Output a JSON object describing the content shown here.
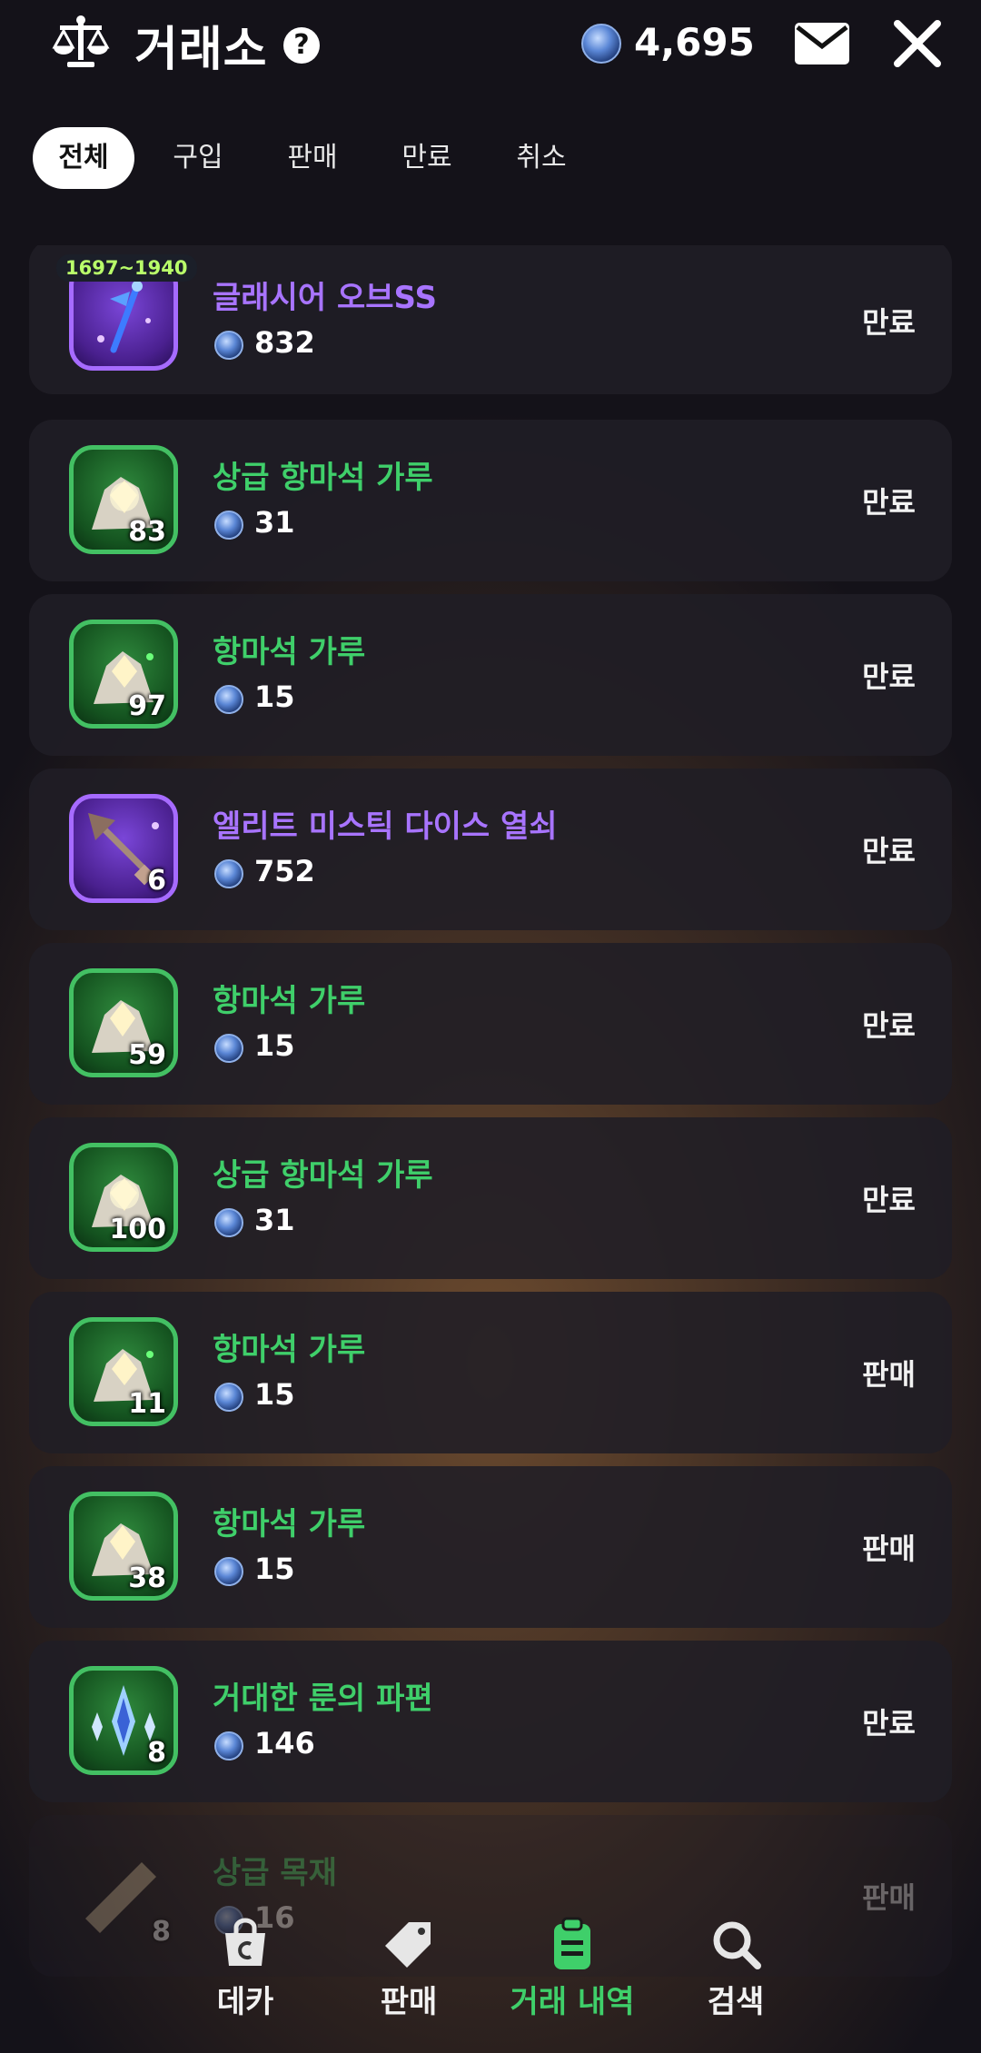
{
  "header": {
    "title": "거래소",
    "help_icon": "question-icon",
    "balance": "4,695",
    "mail_icon": "mail-icon",
    "close_icon": "close-icon"
  },
  "tabs": [
    {
      "label": "전체",
      "active": true
    },
    {
      "label": "구입",
      "active": false
    },
    {
      "label": "판매",
      "active": false
    },
    {
      "label": "만료",
      "active": false
    },
    {
      "label": "취소",
      "active": false
    }
  ],
  "items": [
    {
      "name": "글래시어 오브SS",
      "price": "832",
      "status": "만료",
      "quantity": "",
      "level_range": "1697~1940",
      "rarity": "purple",
      "icon": "staff-icon"
    },
    {
      "name": "상급 항마석 가루",
      "price": "31",
      "status": "만료",
      "quantity": "83",
      "rarity": "green",
      "icon": "ore-icon"
    },
    {
      "name": "항마석 가루",
      "price": "15",
      "status": "만료",
      "quantity": "97",
      "rarity": "green",
      "icon": "ore-icon"
    },
    {
      "name": "엘리트 미스틱 다이스 열쇠",
      "price": "752",
      "status": "만료",
      "quantity": "6",
      "rarity": "purple",
      "icon": "key-icon"
    },
    {
      "name": "항마석 가루",
      "price": "15",
      "status": "만료",
      "quantity": "59",
      "rarity": "green",
      "icon": "ore-icon"
    },
    {
      "name": "상급 항마석 가루",
      "price": "31",
      "status": "만료",
      "quantity": "100",
      "rarity": "green",
      "icon": "ore-icon"
    },
    {
      "name": "항마석 가루",
      "price": "15",
      "status": "판매",
      "quantity": "11",
      "rarity": "green",
      "icon": "ore-icon"
    },
    {
      "name": "항마석 가루",
      "price": "15",
      "status": "판매",
      "quantity": "38",
      "rarity": "green",
      "icon": "ore-icon"
    },
    {
      "name": "거대한 룬의 파편",
      "price": "146",
      "status": "만료",
      "quantity": "8",
      "rarity": "green",
      "icon": "crystal-icon"
    },
    {
      "name": "상급 목재",
      "price": "16",
      "status": "판매",
      "quantity": "8",
      "rarity": "plain",
      "icon": "plank-icon"
    }
  ],
  "bottom_nav": [
    {
      "label": "데카",
      "icon": "bag-icon",
      "active": false
    },
    {
      "label": "판매",
      "icon": "tag-icon",
      "active": false
    },
    {
      "label": "거래 내역",
      "icon": "clipboard-icon",
      "active": true
    },
    {
      "label": "검색",
      "icon": "search-icon",
      "active": false
    }
  ],
  "colors": {
    "accent_green": "#3fcf6a",
    "rarity_purple": "#a874ff",
    "background": "#0f0e14"
  }
}
